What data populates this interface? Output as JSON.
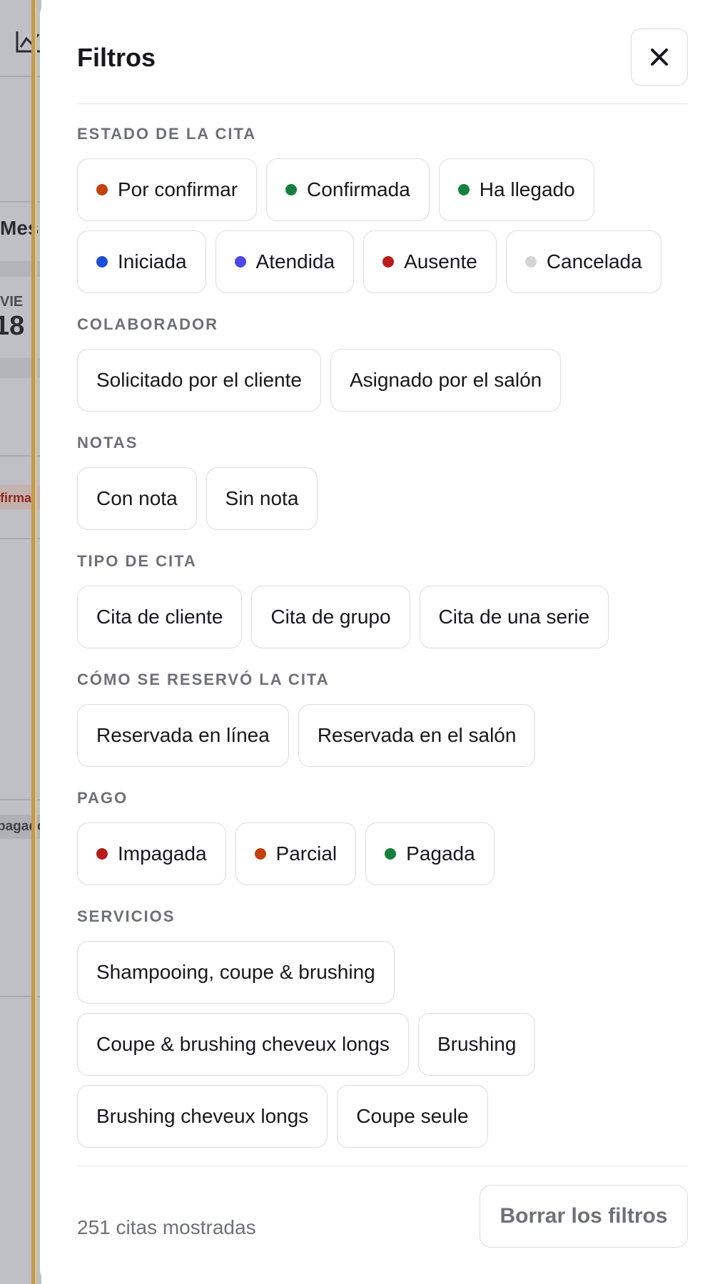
{
  "background": {
    "view_label": "Mes",
    "day_label": "VIE",
    "day_number": "18",
    "status_snippet": "firmar",
    "payment_snippet": "pagado",
    "icon": "chart-line-icon"
  },
  "panel": {
    "title": "Filtros",
    "close_icon": "close-icon"
  },
  "colors": {
    "orange": "#c2410c",
    "green": "#15803d",
    "blue": "#1d4ed8",
    "violet": "#4f46e5",
    "red": "#b91c1c",
    "gray": "#d4d4d8"
  },
  "sections": {
    "estado": {
      "title": "ESTADO DE LA CITA",
      "chips": [
        {
          "label": "Por confirmar",
          "color": "#c2410c"
        },
        {
          "label": "Confirmada",
          "color": "#15803d"
        },
        {
          "label": "Ha llegado",
          "color": "#15803d"
        },
        {
          "label": "Iniciada",
          "color": "#1d4ed8"
        },
        {
          "label": "Atendida",
          "color": "#4f46e5"
        },
        {
          "label": "Ausente",
          "color": "#b91c1c"
        },
        {
          "label": "Cancelada",
          "color": "#d4d4d8"
        }
      ]
    },
    "colaborador": {
      "title": "COLABORADOR",
      "chips": [
        {
          "label": "Solicitado por el cliente"
        },
        {
          "label": "Asignado por el salón"
        }
      ]
    },
    "notas": {
      "title": "NOTAS",
      "chips": [
        {
          "label": "Con nota"
        },
        {
          "label": "Sin nota"
        }
      ]
    },
    "tipo": {
      "title": "TIPO DE CITA",
      "chips": [
        {
          "label": "Cita de cliente"
        },
        {
          "label": "Cita de grupo"
        },
        {
          "label": "Cita de una serie"
        }
      ]
    },
    "reserva": {
      "title": "CÓMO SE RESERVÓ LA CITA",
      "chips": [
        {
          "label": "Reservada en línea"
        },
        {
          "label": "Reservada en el salón"
        }
      ]
    },
    "pago": {
      "title": "PAGO",
      "chips": [
        {
          "label": "Impagada",
          "color": "#b91c1c"
        },
        {
          "label": "Parcial",
          "color": "#c2410c"
        },
        {
          "label": "Pagada",
          "color": "#15803d"
        }
      ]
    },
    "servicios": {
      "title": "SERVICIOS",
      "chips": [
        {
          "label": "Shampooing, coupe & brushing"
        },
        {
          "label": "Coupe & brushing cheveux longs"
        },
        {
          "label": "Brushing"
        },
        {
          "label": "Brushing cheveux longs"
        },
        {
          "label": "Coupe seule"
        }
      ]
    }
  },
  "footer": {
    "count_text": "251 citas mostradas",
    "clear_label": "Borrar los filtros"
  }
}
